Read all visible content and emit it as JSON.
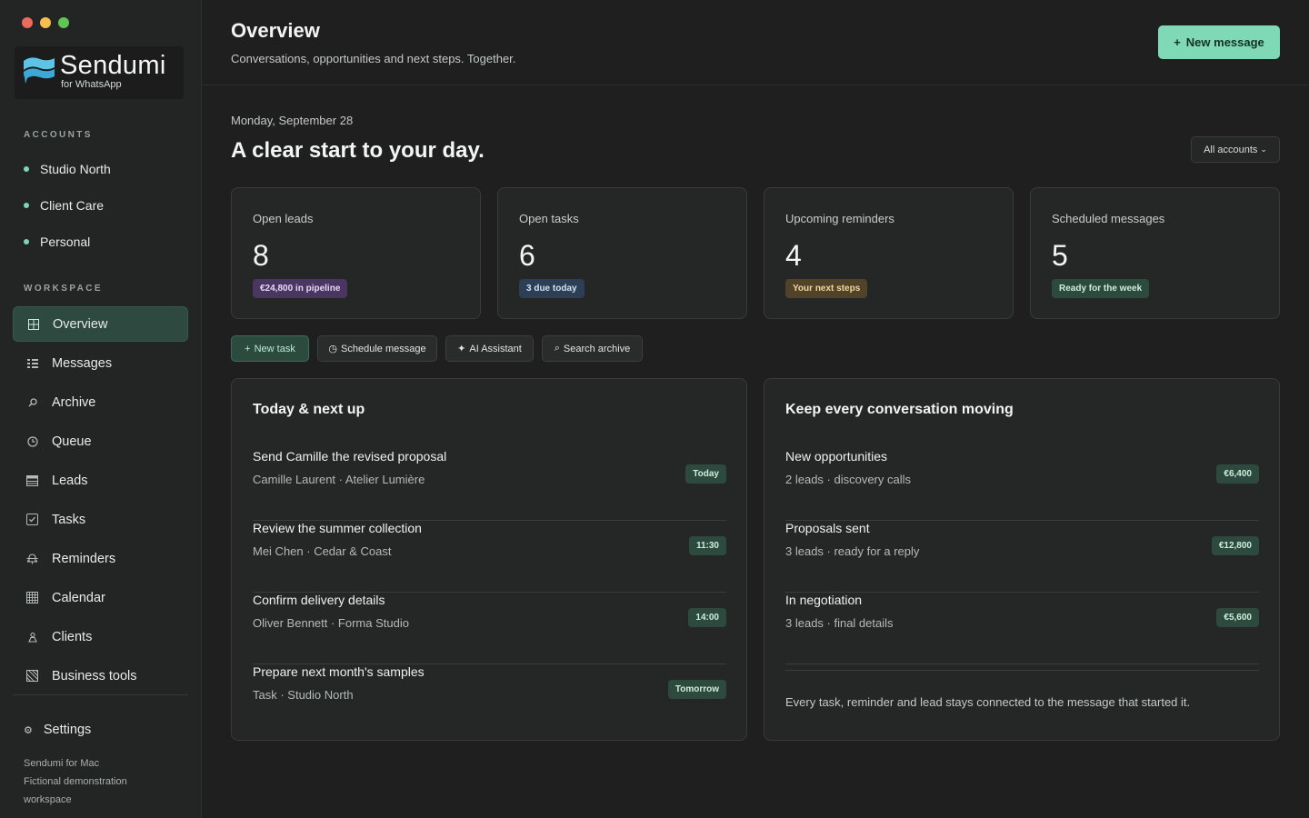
{
  "brand": {
    "name": "Sendumi",
    "subtitle": "for WhatsApp",
    "accent": "#7fd9b6"
  },
  "sidebar": {
    "accounts_label": "ACCOUNTS",
    "accounts": [
      {
        "label": "Studio North"
      },
      {
        "label": "Client Care"
      },
      {
        "label": "Personal"
      }
    ],
    "workspace_label": "WORKSPACE",
    "items": [
      {
        "label": "Overview",
        "icon": "grid-icon",
        "active": true
      },
      {
        "label": "Messages",
        "icon": "list-icon"
      },
      {
        "label": "Archive",
        "icon": "search-icon"
      },
      {
        "label": "Queue",
        "icon": "clock-icon"
      },
      {
        "label": "Leads",
        "icon": "table-icon"
      },
      {
        "label": "Tasks",
        "icon": "checkbox-icon"
      },
      {
        "label": "Reminders",
        "icon": "bell-icon"
      },
      {
        "label": "Calendar",
        "icon": "calendar-icon"
      },
      {
        "label": "Clients",
        "icon": "person-icon"
      },
      {
        "label": "Business tools",
        "icon": "tools-icon"
      }
    ],
    "settings_label": "Settings",
    "footer_lines": [
      "Sendumi for Mac",
      "Fictional demonstration",
      "workspace"
    ]
  },
  "header": {
    "title": "Overview",
    "subtitle": "Conversations, opportunities and next steps. Together.",
    "new_message_label": "New message",
    "new_message_plus": "+"
  },
  "main": {
    "date": "Monday, September 28",
    "greeting": "A clear start to your day.",
    "account_filter": "All accounts",
    "stats": [
      {
        "label": "Open leads",
        "value": "8",
        "badge": "€24,800 in pipeline",
        "badge_color": "#4a3660"
      },
      {
        "label": "Open tasks",
        "value": "6",
        "badge": "3 due today",
        "badge_color": "#2c3f55"
      },
      {
        "label": "Upcoming reminders",
        "value": "4",
        "badge": "Your next steps",
        "badge_color": "#51432a"
      },
      {
        "label": "Scheduled messages",
        "value": "5",
        "badge": "Ready for the week",
        "badge_color": "#2c4a3e"
      }
    ],
    "quick_actions": [
      {
        "icon": "+",
        "label": "New task"
      },
      {
        "icon": "◷",
        "label": "Schedule message"
      },
      {
        "icon": "✦",
        "label": "AI Assistant"
      },
      {
        "icon": "⌕",
        "label": "Search archive"
      }
    ],
    "today": {
      "title": "Today & next up",
      "items": [
        {
          "title": "Send Camille the revised proposal",
          "sub": "Camille Laurent · Atelier Lumière",
          "badge": "Today"
        },
        {
          "title": "Review the summer collection",
          "sub": "Mei Chen · Cedar & Coast",
          "badge": "11:30"
        },
        {
          "title": "Confirm delivery details",
          "sub": "Oliver Bennett · Forma Studio",
          "badge": "14:00"
        },
        {
          "title": "Prepare next month's samples",
          "sub": "Task · Studio North",
          "badge": "Tomorrow"
        }
      ]
    },
    "pipeline": {
      "title": "Keep every conversation moving",
      "items": [
        {
          "title": "New opportunities",
          "sub": "2 leads · discovery calls",
          "badge": "€6,400"
        },
        {
          "title": "Proposals sent",
          "sub": "3 leads · ready for a reply",
          "badge": "€12,800"
        },
        {
          "title": "In negotiation",
          "sub": "3 leads · final details",
          "badge": "€5,600"
        }
      ],
      "note": "Every task, reminder and lead stays connected to the message that started it."
    }
  }
}
